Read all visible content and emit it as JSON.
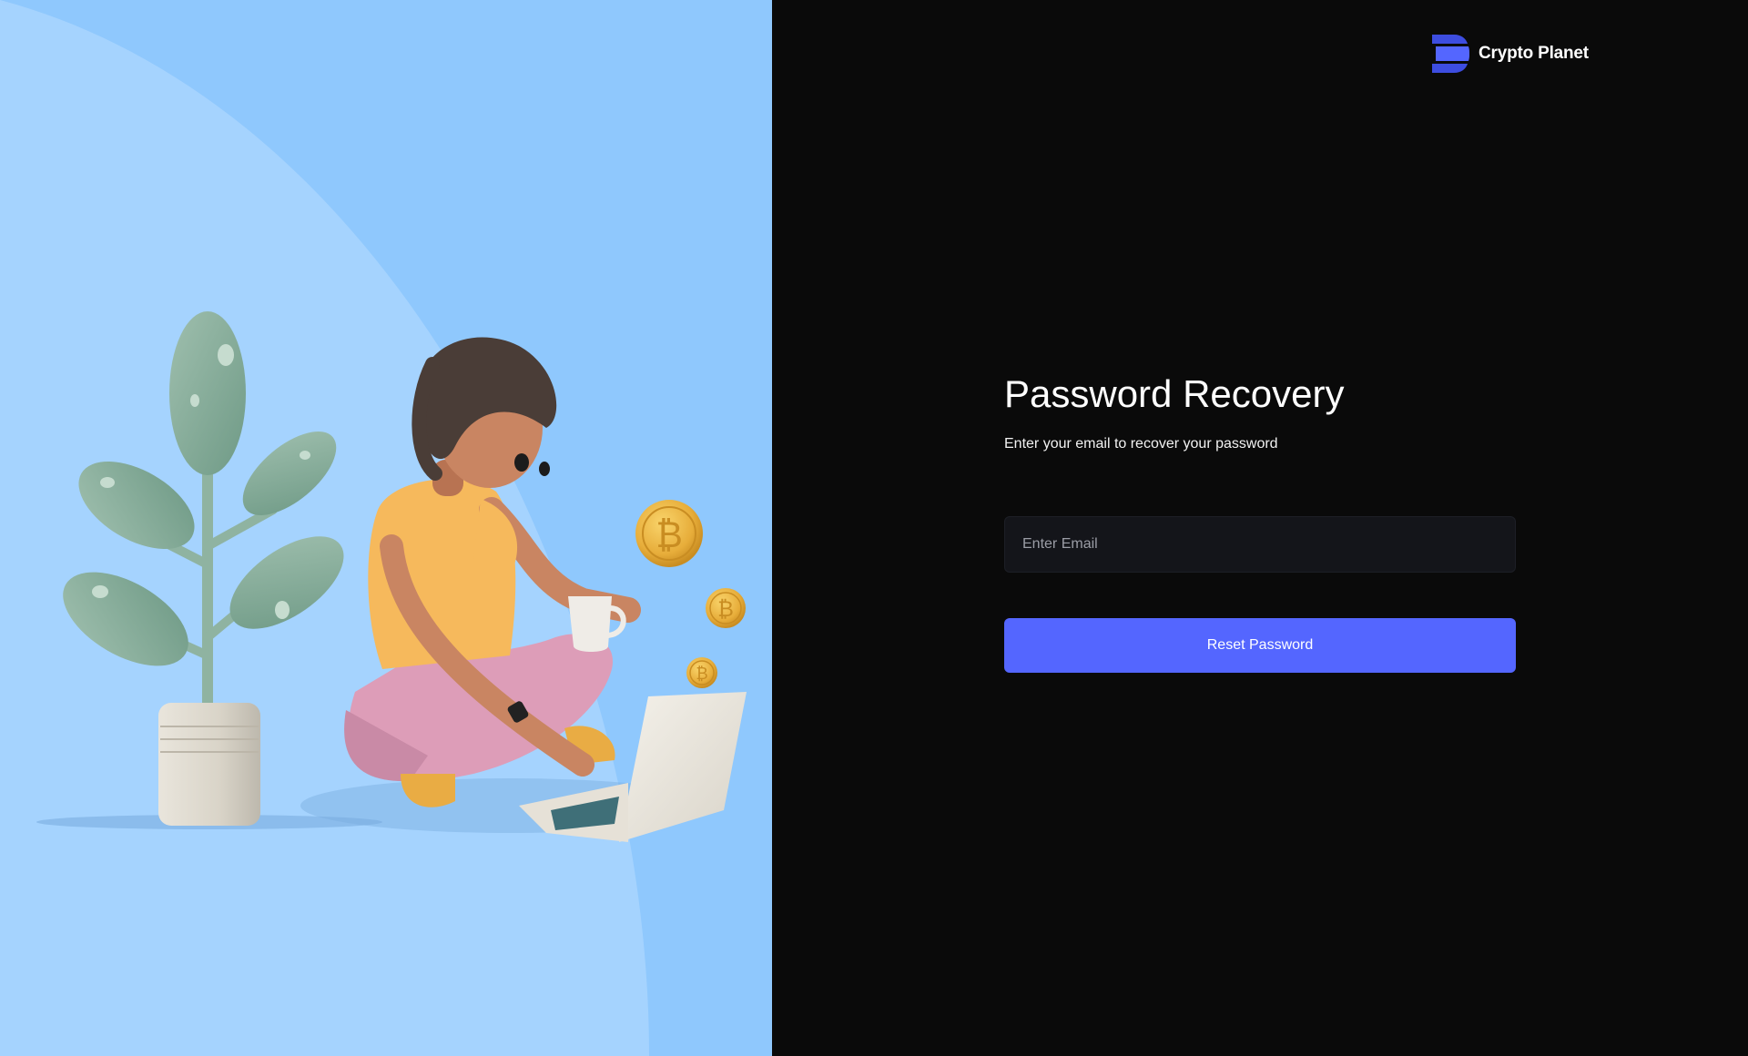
{
  "brand": {
    "name": "Crypto Planet",
    "logo_icon": "layered-d-logo-icon"
  },
  "recovery": {
    "title": "Password Recovery",
    "subtitle": "Enter your email to recover your password",
    "email_placeholder": "Enter Email",
    "email_value": "",
    "submit_label": "Reset Password"
  },
  "illustration": {
    "description_icons": [
      "plant-illustration",
      "woman-with-laptop-illustration",
      "bitcoin-coin-icon"
    ],
    "coin_symbol": "₿"
  },
  "colors": {
    "left_background": "#8fc8fd",
    "right_background": "#0a0a0a",
    "accent": "#5466ff",
    "input_background": "#14151a"
  }
}
